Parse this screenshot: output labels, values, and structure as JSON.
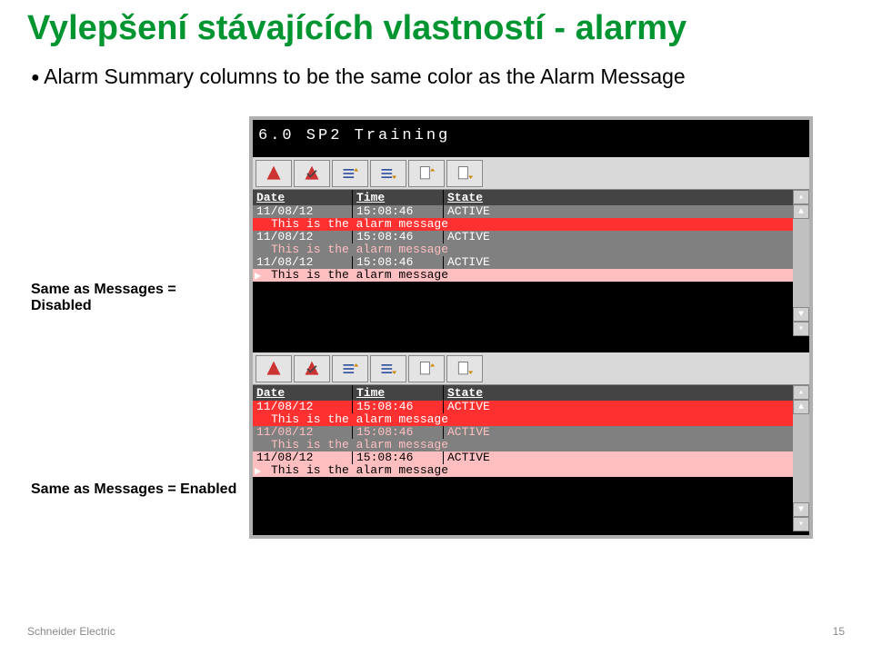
{
  "title": "Vylepšení stávajících vlastností - alarmy",
  "bullet": "Alarm Summary columns to be the same color as the Alarm Message",
  "labels": {
    "disabled": "Same as Messages = Disabled",
    "enabled": "Same as Messages = Enabled"
  },
  "terminal_title": "6.0 SP2 Training",
  "columns": {
    "date": "Date",
    "time": "Time",
    "state": "State"
  },
  "rows": [
    {
      "date": "11/08/12",
      "time": "15:08:46",
      "state": "ACTIVE",
      "msg": "This is the alarm message",
      "bg": "#ff3030",
      "fg": "#fff"
    },
    {
      "date": "11/08/12",
      "time": "15:08:46",
      "state": "ACTIVE",
      "msg": "This is the alarm message",
      "bg": "#808080",
      "fg": "#ffbfc0"
    },
    {
      "date": "11/08/12",
      "time": "15:08:46",
      "state": "ACTIVE",
      "msg": "This is the alarm message",
      "bg": "#ffbfc0",
      "fg": "#000"
    }
  ],
  "footer": {
    "company": "Schneider Electric",
    "page": "15"
  }
}
